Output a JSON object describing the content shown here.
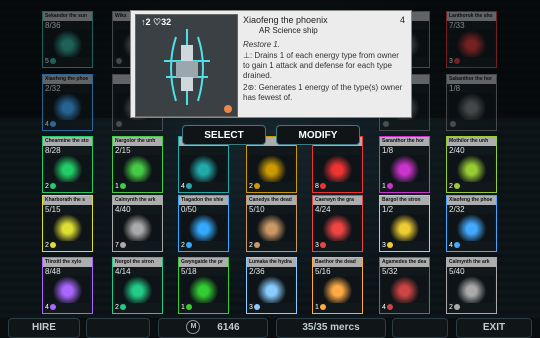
{
  "detail": {
    "stats": "↑2 ♡32",
    "title": "Xiaofeng the phoenix",
    "subtitle": "AR Science ship",
    "cost": "4",
    "ability": "Restore 1.",
    "line1": "⊥: Drains 1 of each energy type from owner to gain 1 attack and defense for each type drained.",
    "line2": "2⊛: Generates 1 energy of the type(s) owner has fewest of."
  },
  "tabs": {
    "select": "SELECT",
    "modify": "MODIFY"
  },
  "bottom": {
    "hire": "HIRE",
    "currency_symbol": "M",
    "money": "6146",
    "mercs": "35/35 mercs",
    "exit": "EXIT"
  },
  "rows": [
    [
      {
        "name": "Sekandor the sun",
        "stats": "8/36",
        "cost": "5",
        "color": "#3a9"
      },
      {
        "name": "Wikx",
        "stats": "",
        "cost": "",
        "color": "#777"
      },
      null,
      null,
      null,
      null,
      null,
      {
        "name": "",
        "stats": "",
        "cost": "",
        "color": "#777"
      },
      {
        "name": "Lanthorok the sho",
        "stats": "7/33",
        "cost": "3",
        "color": "#c33"
      }
    ],
    [
      {
        "name": "Xiaofeng the phoe",
        "stats": "2/32",
        "cost": "4",
        "color": "#4af"
      },
      {
        "name": "",
        "stats": "",
        "cost": "",
        "color": "#777"
      },
      null,
      null,
      null,
      null,
      null,
      {
        "name": "",
        "stats": "",
        "cost": "",
        "color": "#777"
      },
      {
        "name": "Sabanthor the hor",
        "stats": "1/8",
        "cost": "",
        "color": "#777"
      }
    ],
    [
      {
        "name": "Chearmine the sto",
        "stats": "8/28",
        "cost": "2",
        "color": "#2c6"
      },
      {
        "name": "Nargolor the unh",
        "stats": "2/15",
        "cost": "1",
        "color": "#4c4"
      },
      {
        "name": "",
        "stats": "",
        "cost": "4",
        "color": "#2aa"
      },
      {
        "name": "",
        "stats": "",
        "cost": "2",
        "color": "#c90"
      },
      {
        "name": "",
        "stats": "",
        "cost": "8",
        "color": "#e33"
      },
      {
        "name": "Saranthor the hor",
        "stats": "1/8",
        "cost": "1",
        "color": "#c3c"
      },
      {
        "name": "Mothilor the unh",
        "stats": "2/40",
        "cost": "2",
        "color": "#9c3"
      }
    ],
    [
      {
        "name": "Kharborath the s",
        "stats": "5/15",
        "cost": "2",
        "color": "#dd3"
      },
      {
        "name": "Calmynth the ark",
        "stats": "4/40",
        "cost": "7",
        "color": "#aaa"
      },
      {
        "name": "Tiagadon the shie",
        "stats": "0/50",
        "cost": "2",
        "color": "#3af"
      },
      {
        "name": "Canedys the dead",
        "stats": "5/10",
        "cost": "2",
        "color": "#c96"
      },
      {
        "name": "Caerwyn the gra",
        "stats": "4/24",
        "cost": "3",
        "color": "#e44"
      },
      {
        "name": "Bargol the stron",
        "stats": "1/2",
        "cost": "3",
        "color": "#ec3"
      },
      {
        "name": "Xiaofeng the phoe",
        "stats": "2/32",
        "cost": "4",
        "color": "#4af"
      }
    ],
    [
      {
        "name": "Tlinxitl the xylo",
        "stats": "8/48",
        "cost": "4",
        "color": "#a6f"
      },
      {
        "name": "Norgol the stron",
        "stats": "4/14",
        "cost": "2",
        "color": "#2c8"
      },
      {
        "name": "Gwyngaide the pr",
        "stats": "5/18",
        "cost": "1",
        "color": "#3c3"
      },
      {
        "name": "Lumaka the hydra",
        "stats": "2/36",
        "cost": "3",
        "color": "#8cf"
      },
      {
        "name": "Baethor the dead",
        "stats": "5/16",
        "cost": "1",
        "color": "#fa4"
      },
      {
        "name": "Agamedes the dea",
        "stats": "5/32",
        "cost": "4",
        "color": "#c44"
      },
      {
        "name": "Calmynth the ark",
        "stats": "5/40",
        "cost": "2",
        "color": "#aaa"
      }
    ]
  ]
}
